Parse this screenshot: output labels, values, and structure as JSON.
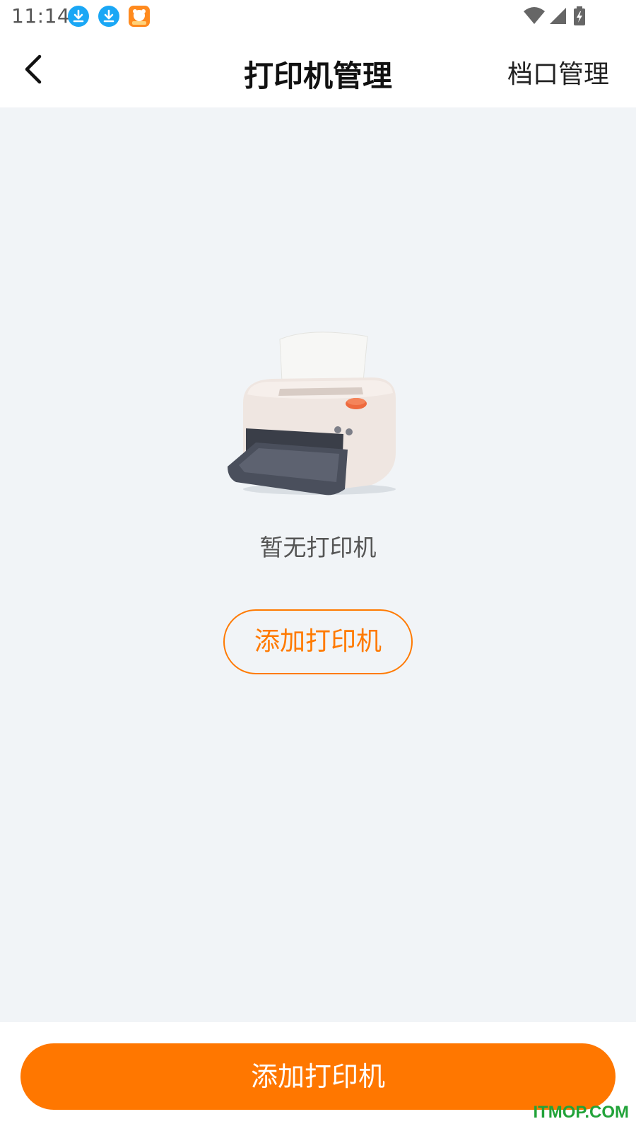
{
  "status_bar": {
    "time": "11:14",
    "icons": [
      "download-icon",
      "download-icon",
      "app-notification-icon",
      "wifi-icon",
      "cell-signal-icon",
      "battery-charging-icon"
    ]
  },
  "header": {
    "back_icon": "chevron-left-icon",
    "title": "打印机管理",
    "action_label": "档口管理"
  },
  "empty_state": {
    "illustration": "printer-icon",
    "message": "暂无打印机",
    "button_label": "添加打印机"
  },
  "bottom_bar": {
    "button_label": "添加打印机"
  },
  "watermark": "ITMOP.COM",
  "colors": {
    "accent": "#ff7700",
    "background": "#f1f4f7",
    "status_download": "#1aa7f5",
    "watermark": "#22a33a"
  }
}
